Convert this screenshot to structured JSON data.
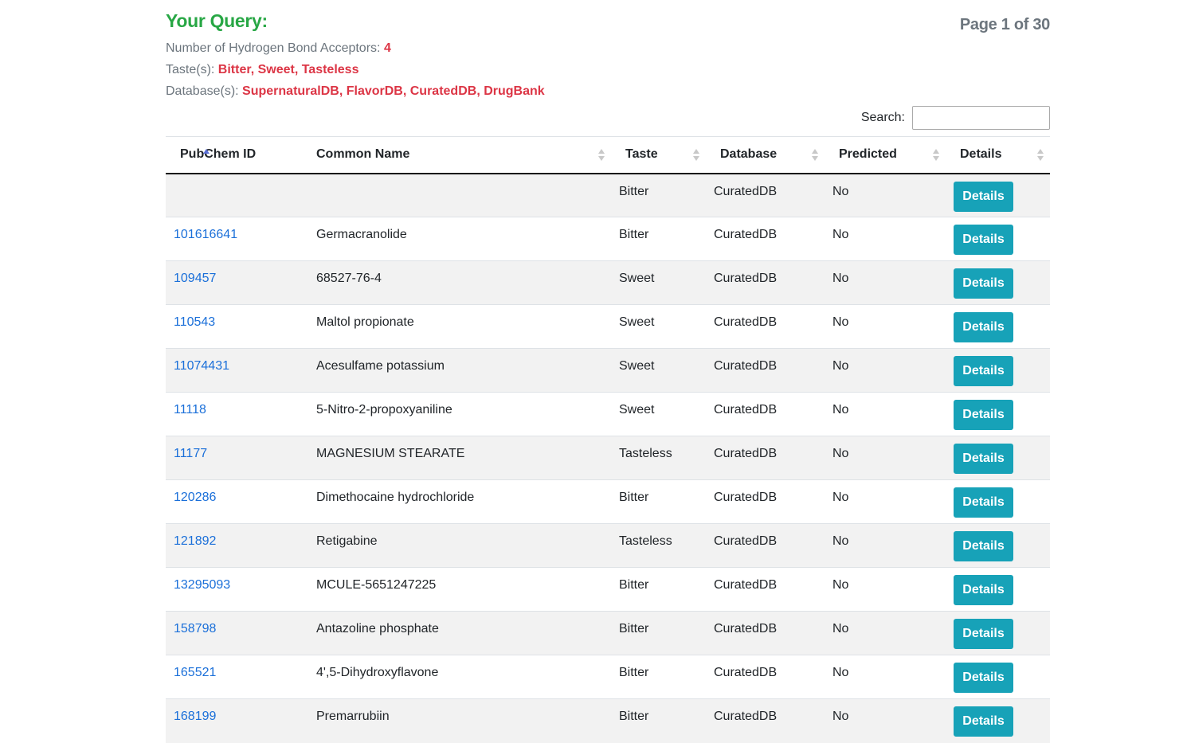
{
  "query": {
    "title": "Your Query:",
    "page_indicator": "Page 1 of 30",
    "hba_label": "Number of Hydrogen Bond Acceptors:",
    "hba_value": "4",
    "taste_label": "Taste(s):",
    "taste_value": "Bitter, Sweet, Tasteless",
    "database_label": "Database(s):",
    "database_value": "SupernaturalDB, FlavorDB, CuratedDB, DrugBank"
  },
  "search": {
    "label": "Search:",
    "value": ""
  },
  "table": {
    "headers": [
      "PubChem ID",
      "Common Name",
      "Taste",
      "Database",
      "Predicted",
      "Details"
    ],
    "sorted_column": "PubChem ID",
    "sort_direction": "ascending",
    "details_label": "Details",
    "rows": [
      {
        "id": "",
        "name": "",
        "taste": "Bitter",
        "database": "CuratedDB",
        "predicted": "No"
      },
      {
        "id": "101616641",
        "name": "Germacranolide",
        "taste": "Bitter",
        "database": "CuratedDB",
        "predicted": "No"
      },
      {
        "id": "109457",
        "name": "68527-76-4",
        "taste": "Sweet",
        "database": "CuratedDB",
        "predicted": "No"
      },
      {
        "id": "110543",
        "name": "Maltol propionate",
        "taste": "Sweet",
        "database": "CuratedDB",
        "predicted": "No"
      },
      {
        "id": "11074431",
        "name": "Acesulfame potassium",
        "taste": "Sweet",
        "database": "CuratedDB",
        "predicted": "No"
      },
      {
        "id": "11118",
        "name": "5-Nitro-2-propoxyaniline",
        "taste": "Sweet",
        "database": "CuratedDB",
        "predicted": "No"
      },
      {
        "id": "11177",
        "name": "MAGNESIUM STEARATE",
        "taste": "Tasteless",
        "database": "CuratedDB",
        "predicted": "No"
      },
      {
        "id": "120286",
        "name": "Dimethocaine hydrochloride",
        "taste": "Bitter",
        "database": "CuratedDB",
        "predicted": "No"
      },
      {
        "id": "121892",
        "name": "Retigabine",
        "taste": "Tasteless",
        "database": "CuratedDB",
        "predicted": "No"
      },
      {
        "id": "13295093",
        "name": "MCULE-5651247225",
        "taste": "Bitter",
        "database": "CuratedDB",
        "predicted": "No"
      },
      {
        "id": "158798",
        "name": "Antazoline phosphate",
        "taste": "Bitter",
        "database": "CuratedDB",
        "predicted": "No"
      },
      {
        "id": "165521",
        "name": "4',5-Dihydroxyflavone",
        "taste": "Bitter",
        "database": "CuratedDB",
        "predicted": "No"
      },
      {
        "id": "168199",
        "name": "Premarrubiin",
        "taste": "Bitter",
        "database": "CuratedDB",
        "predicted": "No"
      }
    ]
  },
  "colors": {
    "title_green": "#28a745",
    "value_red": "#dc3545",
    "link_blue": "#1a6fd9",
    "button_teal": "#17a2b8",
    "sort_active": "#5a6fd6"
  }
}
